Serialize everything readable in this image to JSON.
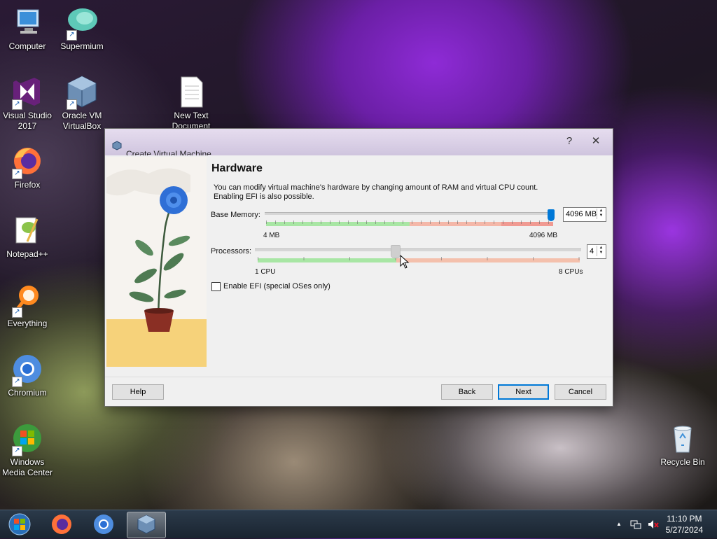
{
  "desktop": {
    "icons": [
      {
        "label": "Computer"
      },
      {
        "label": "Supermium"
      },
      {
        "label": "Visual Studio 2017"
      },
      {
        "label": "Oracle VM VirtualBox"
      },
      {
        "label": "New Text Document"
      },
      {
        "label": "Firefox"
      },
      {
        "label": "Notepad++"
      },
      {
        "label": "Everything"
      },
      {
        "label": "Chromium"
      },
      {
        "label": "Windows Media Center"
      },
      {
        "label": "Recycle Bin"
      }
    ]
  },
  "dialog": {
    "title": "Create Virtual Machine",
    "help_symbol": "?",
    "close_symbol": "✕",
    "heading": "Hardware",
    "description": "You can modify virtual machine's hardware by changing amount of RAM and virtual CPU count. Enabling EFI is also possible.",
    "memory": {
      "label": "Base Memory:",
      "value": "4096 MB",
      "min_label": "4 MB",
      "max_label": "4096 MB",
      "level": 1.0
    },
    "processors": {
      "label": "Processors:",
      "value": "4",
      "min_label": "1 CPU",
      "max_label": "8 CPUs",
      "level": 0.43
    },
    "efi": {
      "label": "Enable EFI (special OSes only)",
      "checked": false
    },
    "buttons": {
      "help": "Help",
      "back": "Back",
      "next": "Next",
      "cancel": "Cancel"
    }
  },
  "taskbar": {
    "items": [
      "start-orb",
      "firefox",
      "chromium",
      "virtualbox"
    ],
    "active": "virtualbox",
    "time": "11:10 PM",
    "date": "5/27/2024",
    "tray_arrow": "▲"
  },
  "colors": {
    "accent": "#0078d7",
    "slider_green": "#9ee39a",
    "slider_red": "#f2a99a",
    "art_yellow": "#f6d27a"
  }
}
